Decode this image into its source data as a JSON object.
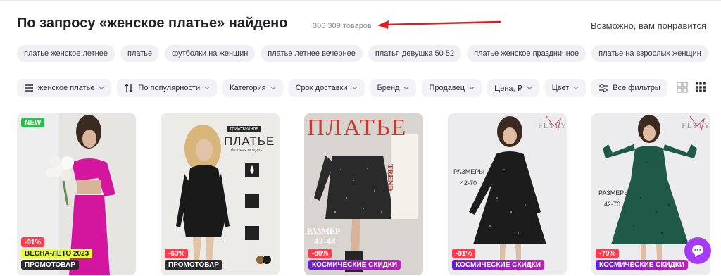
{
  "header": {
    "title": "По запросу «женское платье» найдено",
    "count": "306 309 товаров",
    "recommend": "Возможно, вам понравится"
  },
  "suggestions": [
    "платье женское летнее",
    "платье",
    "футболки на женщин",
    "платье летнее вечернее",
    "платья девушка 50 52",
    "платье женское праздничное",
    "платье на взрослых женщин"
  ],
  "filters": {
    "query": "женское платье",
    "sort": "По популярности",
    "category": "Категория",
    "delivery": "Срок доставки",
    "brand": "Бренд",
    "seller": "Продавец",
    "price": "Цена, ₽",
    "color": "Цвет",
    "all": "Все фильтры"
  },
  "products": [
    {
      "badge_new": "NEW",
      "discount": "-91%",
      "tags": [
        "ВЕСНА-ЛЕТО 2023",
        "ПРОМОТОВАР"
      ]
    },
    {
      "discount": "-63%",
      "tags": [
        "ПРОМОТОВАР"
      ],
      "label_top": "трикотажное",
      "label_main": "ПЛАТЬЕ",
      "label_sub": "базовая модель"
    },
    {
      "discount": "-80%",
      "tags": [
        "КОСМИЧЕСКИЕ СКИДКИ"
      ],
      "headline": "ПЛАТЬЕ",
      "size_label": "РАЗМЕР",
      "size_value": "42-48",
      "side_text": "TREND"
    },
    {
      "discount": "-81%",
      "tags": [
        "КОСМИЧЕСКИЕ СКИДКИ"
      ],
      "size_label": "РАЗМЕРЫ",
      "size_value": "42-70",
      "brand": "FLYLY"
    },
    {
      "discount": "-79%",
      "tags": [
        "КОСМИЧЕСКИЕ СКИДКИ"
      ],
      "size_label": "РАЗМЕРЫ",
      "size_value": "42-70",
      "brand": "FLYLY"
    }
  ],
  "colors": {
    "accent_red": "#e01b1b",
    "chat": "#a53bf4"
  }
}
